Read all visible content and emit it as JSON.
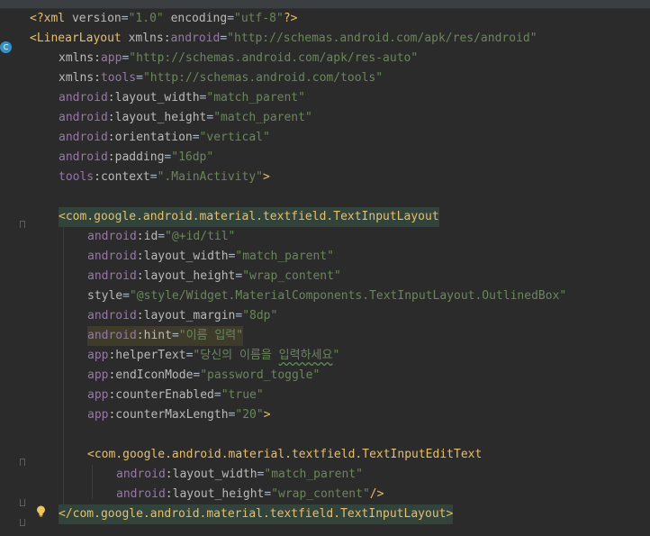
{
  "editor": {
    "language": "xml",
    "lines": [
      [
        [
          "c-punct",
          "<?"
        ],
        [
          "c-tag",
          "xml"
        ],
        [
          "c-text",
          " "
        ],
        [
          "c-attr",
          "version"
        ],
        [
          "c-text",
          "="
        ],
        [
          "c-val",
          "\"1.0\""
        ],
        [
          "c-text",
          " "
        ],
        [
          "c-attr",
          "encoding"
        ],
        [
          "c-text",
          "="
        ],
        [
          "c-val",
          "\"utf-8\""
        ],
        [
          "c-punct",
          "?>"
        ]
      ],
      [
        [
          "c-tag",
          "<LinearLayout"
        ],
        [
          "c-text",
          " "
        ],
        [
          "c-attr",
          "xmlns:"
        ],
        [
          "c-ns",
          "android"
        ],
        [
          "c-text",
          "="
        ],
        [
          "c-val",
          "\"http://schemas.android.com/apk/res/android\""
        ]
      ],
      [
        [
          "c-attr",
          "xmlns:"
        ],
        [
          "c-ns",
          "app"
        ],
        [
          "c-text",
          "="
        ],
        [
          "c-val",
          "\"http://schemas.android.com/apk/res-auto\""
        ]
      ],
      [
        [
          "c-attr",
          "xmlns:"
        ],
        [
          "c-ns",
          "tools"
        ],
        [
          "c-text",
          "="
        ],
        [
          "c-val",
          "\"http://schemas.android.com/tools\""
        ]
      ],
      [
        [
          "c-ns",
          "android"
        ],
        [
          "c-attr",
          ":layout_width"
        ],
        [
          "c-text",
          "="
        ],
        [
          "c-val",
          "\"match_parent\""
        ]
      ],
      [
        [
          "c-ns",
          "android"
        ],
        [
          "c-attr",
          ":layout_height"
        ],
        [
          "c-text",
          "="
        ],
        [
          "c-val",
          "\"match_parent\""
        ]
      ],
      [
        [
          "c-ns",
          "android"
        ],
        [
          "c-attr",
          ":orientation"
        ],
        [
          "c-text",
          "="
        ],
        [
          "c-val",
          "\"vertical\""
        ]
      ],
      [
        [
          "c-ns",
          "android"
        ],
        [
          "c-attr",
          ":padding"
        ],
        [
          "c-text",
          "="
        ],
        [
          "c-val",
          "\"16dp\""
        ]
      ],
      [
        [
          "c-ns",
          "tools"
        ],
        [
          "c-attr",
          ":context"
        ],
        [
          "c-text",
          "="
        ],
        [
          "c-val",
          "\".MainActivity\""
        ],
        [
          "c-tag",
          ">"
        ]
      ],
      [],
      [
        [
          "c-tag",
          "<com.google.android.material.textfield.TextInputLayout"
        ]
      ],
      [
        [
          "c-ns",
          "android"
        ],
        [
          "c-attr",
          ":id"
        ],
        [
          "c-text",
          "="
        ],
        [
          "c-val",
          "\"@+id/til\""
        ]
      ],
      [
        [
          "c-ns",
          "android"
        ],
        [
          "c-attr",
          ":layout_width"
        ],
        [
          "c-text",
          "="
        ],
        [
          "c-val",
          "\"match_parent\""
        ]
      ],
      [
        [
          "c-ns",
          "android"
        ],
        [
          "c-attr",
          ":layout_height"
        ],
        [
          "c-text",
          "="
        ],
        [
          "c-val",
          "\"wrap_content\""
        ]
      ],
      [
        [
          "c-attr",
          "style"
        ],
        [
          "c-text",
          "="
        ],
        [
          "c-val",
          "\"@style/Widget.MaterialComponents.TextInputLayout.OutlinedBox\""
        ]
      ],
      [
        [
          "c-ns",
          "android"
        ],
        [
          "c-attr",
          ":layout_margin"
        ],
        [
          "c-text",
          "="
        ],
        [
          "c-val",
          "\"8dp\""
        ]
      ],
      [
        [
          "c-ns",
          "android"
        ],
        [
          "c-attr",
          ":hint"
        ],
        [
          "c-text",
          "="
        ],
        [
          "c-val",
          "\"이름 입력\""
        ]
      ],
      [
        [
          "c-ns",
          "app"
        ],
        [
          "c-attr",
          ":helperText"
        ],
        [
          "c-text",
          "="
        ],
        [
          "c-val",
          "\"당신의 이름을 "
        ],
        [
          "c-val c-squiggle",
          "입력하세요"
        ],
        [
          "c-val",
          "\""
        ]
      ],
      [
        [
          "c-ns",
          "app"
        ],
        [
          "c-attr",
          ":endIconMode"
        ],
        [
          "c-text",
          "="
        ],
        [
          "c-val",
          "\"password_toggle\""
        ]
      ],
      [
        [
          "c-ns",
          "app"
        ],
        [
          "c-attr",
          ":counterEnabled"
        ],
        [
          "c-text",
          "="
        ],
        [
          "c-val",
          "\"true\""
        ]
      ],
      [
        [
          "c-ns",
          "app"
        ],
        [
          "c-attr",
          ":counterMaxLength"
        ],
        [
          "c-text",
          "="
        ],
        [
          "c-val",
          "\"20\""
        ],
        [
          "c-tag",
          ">"
        ]
      ],
      [],
      [
        [
          "c-tag",
          "<com.google.android.material.textfield.TextInputEditText"
        ]
      ],
      [
        [
          "c-ns",
          "android"
        ],
        [
          "c-attr",
          ":layout_width"
        ],
        [
          "c-text",
          "="
        ],
        [
          "c-val",
          "\"match_parent\""
        ]
      ],
      [
        [
          "c-ns",
          "android"
        ],
        [
          "c-attr",
          ":layout_height"
        ],
        [
          "c-text",
          "="
        ],
        [
          "c-val",
          "\"wrap_content\""
        ],
        [
          "c-tag",
          "/>"
        ]
      ],
      [
        [
          "c-tag",
          "</com.google.android.material.textfield.TextInputLayout>"
        ]
      ]
    ]
  },
  "gutter": {
    "class_icon": "c-class-icon",
    "class_icon_label": "C",
    "bulb_icon": "lightbulb-icon"
  },
  "colors": {
    "background": "#2b2b2b",
    "tag": "#e8bf6a",
    "namespace": "#9876aa",
    "attribute": "#bababa",
    "value": "#6a8759",
    "text": "#a9b7c6"
  }
}
